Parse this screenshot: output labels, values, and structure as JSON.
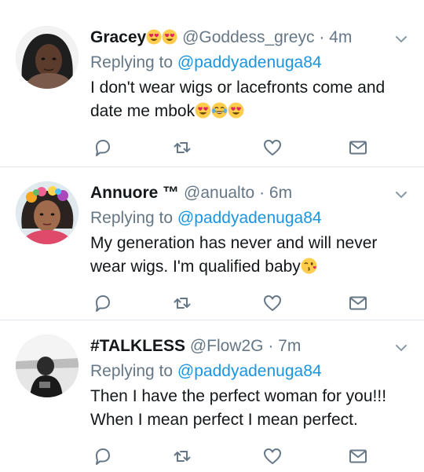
{
  "tweets": [
    {
      "name": "Gracey",
      "handle": "@Goddess_greyc",
      "separator": "·",
      "time": "4m",
      "replying_prefix": "Replying to",
      "reply_to": "@paddyadenuga84",
      "text_line_1": "I don't  wear wigs or lacefronts come and",
      "text_line_2": "date me mbok",
      "name_emojis": [
        "heart-eyes",
        "heart-eyes"
      ],
      "text_emojis": [
        "heart-eyes",
        "tears-of-joy",
        "heart-eyes"
      ]
    },
    {
      "name": "Annuore ™",
      "handle": "@anualto",
      "separator": "·",
      "time": "6m",
      "replying_prefix": "Replying to",
      "reply_to": "@paddyadenuga84",
      "text_line_1": "My generation has never and will never",
      "text_line_2": "wear wigs. I'm qualified baby",
      "text_emojis": [
        "kissing-wink"
      ]
    },
    {
      "name": "#TALKLESS",
      "handle": "@Flow2G",
      "separator": "·",
      "time": "7m",
      "replying_prefix": "Replying to",
      "reply_to": "@paddyadenuga84",
      "text_line_1": "Then I have the perfect woman for you!!!",
      "text_line_2": "When I mean perfect I mean perfect."
    }
  ],
  "colors": {
    "link": "#1b95e0",
    "secondary": "#657786",
    "primary_text": "#14171a",
    "divider": "#e1e8ed"
  },
  "icons": {
    "reply": "speech-bubble",
    "retweet": "retweet-arrows",
    "like": "heart-outline",
    "dm": "envelope"
  }
}
